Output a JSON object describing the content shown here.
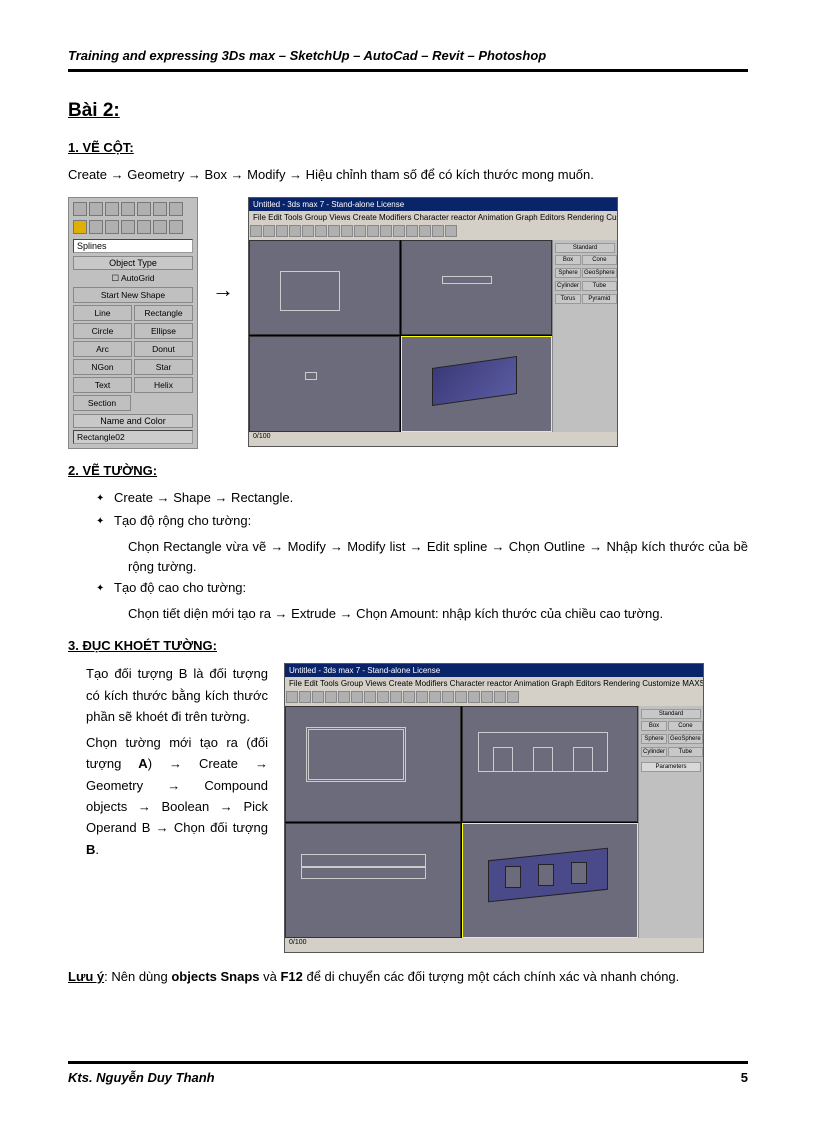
{
  "header": "Training and expressing 3Ds max – SketchUp – AutoCad – Revit – Photoshop",
  "title": "Bài 2:",
  "section1": {
    "heading": "1.  VẼ CỘT:",
    "text": "Create → Geometry → Box → Modify → Hiệu chỉnh tham số để có kích thước mong muốn."
  },
  "panel": {
    "dropdown": "Splines",
    "rollout1": "Object Type",
    "autogrid": "AutoGrid",
    "startnew": "Start New Shape",
    "buttons": [
      "Line",
      "Rectangle",
      "Circle",
      "Ellipse",
      "Arc",
      "Donut",
      "NGon",
      "Star",
      "Text",
      "Helix",
      "Section"
    ],
    "rollout2": "Name and Color",
    "namefield": "Rectangle02"
  },
  "arrow": "→",
  "app": {
    "title": "Untitled - 3ds max 7 - Stand-alone License",
    "menu": "File  Edit  Tools  Group  Views  Create  Modifiers  Character  reactor  Animation  Graph Editors  Rendering  Customize  MAXScript  Help",
    "side_buttons": [
      "Standard",
      "Box",
      "Cone",
      "Sphere",
      "GeoSphere",
      "Cylinder",
      "Tube",
      "Torus",
      "Pyramid"
    ],
    "status": "0/100"
  },
  "section2": {
    "heading": "2.  VẼ TƯỜNG:",
    "b1": "Create → Shape → Rectangle.",
    "b2": "Tạo độ rộng cho tường:",
    "b2_sub": "Chọn Rectangle vừa vẽ → Modify → Modify list → Edit spline → Chọn  Outline → Nhập kích thước của bề rộng tường.",
    "b3": "Tạo độ cao cho tường:",
    "b3_sub": "Chọn tiết diện mới tạo ra → Extrude → Chọn Amount: nhập kích thước của chiều cao tường."
  },
  "section3": {
    "heading": "3.  ĐỤC KHOÉT TƯỜNG:",
    "p1": "Tạo đối tượng B là đối tượng có kích thước bằng kích thước phần sẽ khoét đi trên tường.",
    "p2a": "Chọn tường mới tạo ra (đối tượng ",
    "p2b": "A",
    "p2c": ") → Create → Geometry → Compound objects → Boolean → Pick Operand B → Chọn đối tượng ",
    "p2d": "B",
    "p2e": "."
  },
  "note": {
    "label": "Lưu ý",
    "t1": ": Nên dùng ",
    "t2": "objects Snaps",
    "t3": " và ",
    "t4": "F12",
    "t5": " để di chuyển các đối tượng một cách chính xác và nhanh chóng."
  },
  "footer": {
    "author": "Kts. Nguyễn Duy Thanh",
    "page": "5"
  }
}
